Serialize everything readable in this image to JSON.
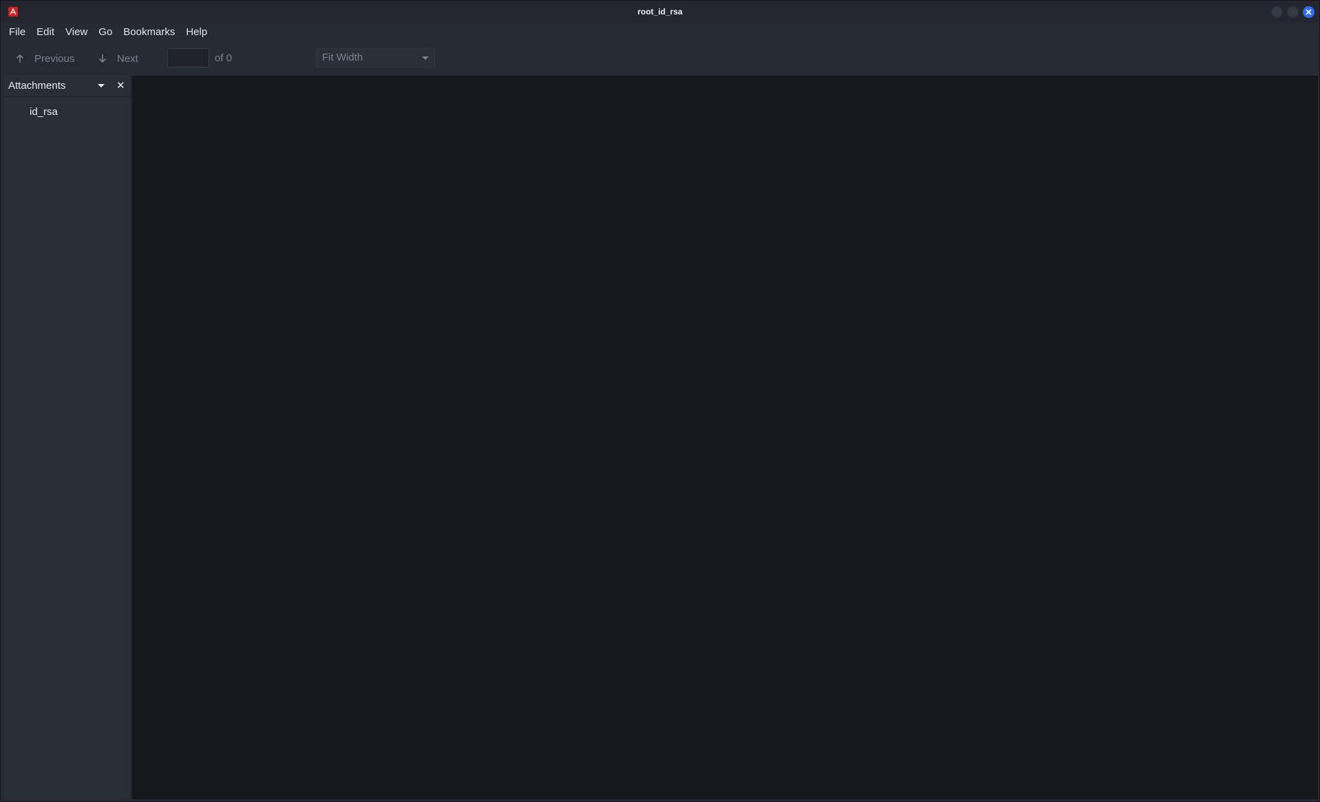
{
  "window": {
    "title": "root_id_rsa",
    "app_icon": "pdf-reader-icon",
    "accent_color": "#2e6bf0"
  },
  "menu": {
    "items": [
      "File",
      "Edit",
      "View",
      "Go",
      "Bookmarks",
      "Help"
    ]
  },
  "toolbar": {
    "previous_label": "Previous",
    "next_label": "Next",
    "page_value": "",
    "page_of": "of 0",
    "zoom_value": "Fit Width"
  },
  "sidebar": {
    "title": "Attachments",
    "close_glyph": "✕",
    "items": [
      {
        "label": "id_rsa"
      }
    ]
  }
}
